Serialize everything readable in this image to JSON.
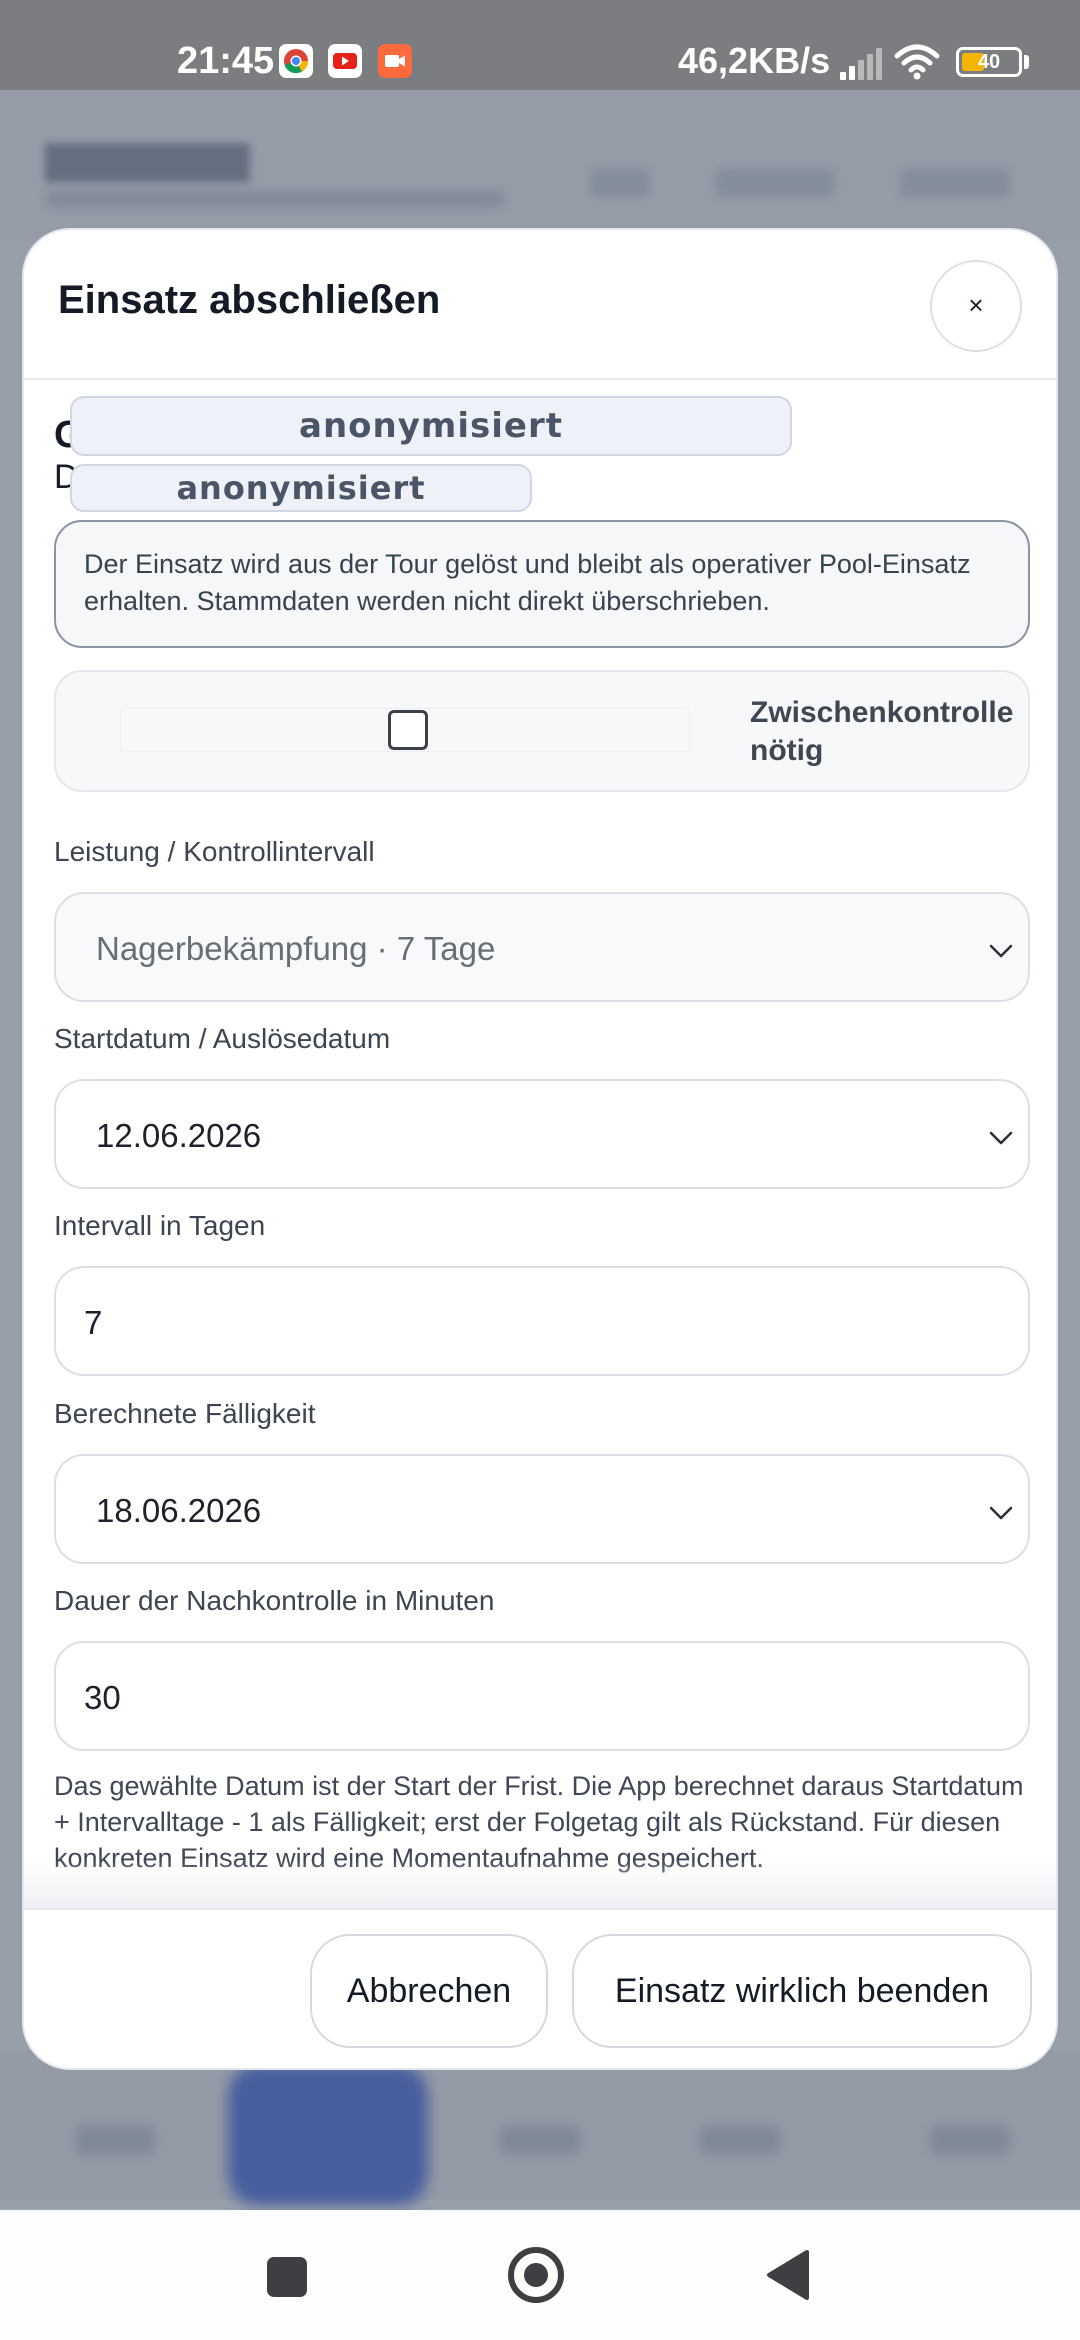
{
  "status_bar": {
    "time": "21:45",
    "network_speed": "46,2KB/s",
    "battery": "40",
    "app_icons": [
      "chrome-icon",
      "youtube-icon",
      "camera-icon"
    ],
    "battery_level": 0.4
  },
  "modal": {
    "title": "Einsatz abschließen",
    "close_label": "×",
    "heading_fragment": "G",
    "subheading_fragment": "D",
    "redaction_1": "anonymisiert",
    "redaction_2": "anonymisiert",
    "notice": "Der Einsatz wird aus der Tour gelöst und bleibt als operativer Pool-Einsatz erhalten. Stammdaten werden nicht direkt überschrieben.",
    "checkbox_label": "Zwischenkontrolle nötig",
    "checkbox_checked": false,
    "fields": {
      "service": {
        "label": "Leistung / Kontrollintervall",
        "value": "Nagerbekämpfung · 7 Tage"
      },
      "start_date": {
        "label": "Startdatum / Auslösedatum",
        "value": "12.06.2026"
      },
      "interval": {
        "label": "Intervall in Tagen",
        "value": "7"
      },
      "due_date": {
        "label": "Berechnete Fälligkeit",
        "value": "18.06.2026"
      },
      "duration": {
        "label": "Dauer der Nachkontrolle in Minuten",
        "value": "30"
      }
    },
    "hint": "Das gewählte Datum ist der Start der Frist. Die App berechnet daraus Startdatum + Intervalltage - 1 als Fälligkeit; erst der Folgetag gilt als Rückstand. Für diesen konkreten Einsatz wird eine Momentaufnahme gespeichert.",
    "cancel_label": "Abbrechen",
    "confirm_label": "Einsatz wirklich beenden"
  },
  "colors": {
    "accent": "#3f5fc8",
    "battery": "#f5b400",
    "text": "#151b26"
  }
}
